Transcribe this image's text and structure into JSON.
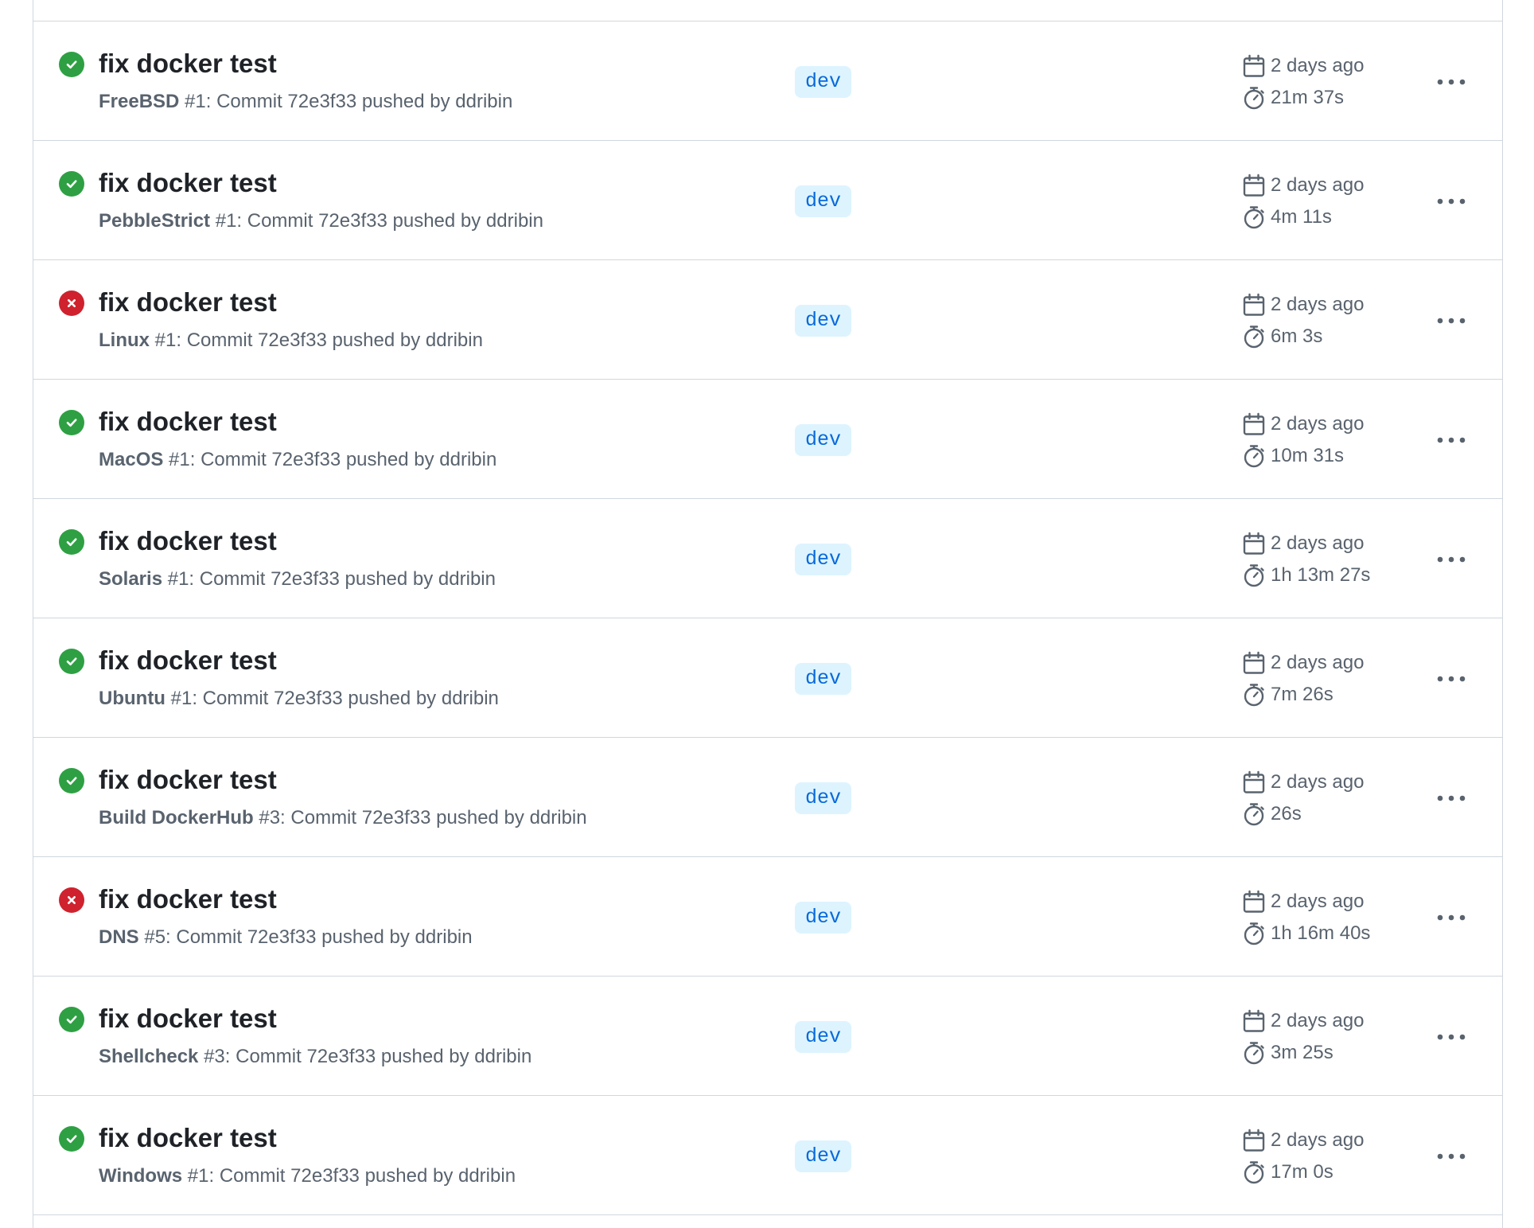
{
  "colors": {
    "success": "#2ea043",
    "failure": "#cf222e",
    "branch_bg": "#ddf4ff",
    "branch_fg": "#0969da",
    "muted": "#59636e",
    "border": "#d0d7de"
  },
  "icons": {
    "success": "check-circle-fill-icon",
    "failure": "x-circle-fill-icon",
    "date": "calendar-icon",
    "duration": "stopwatch-icon",
    "menu": "kebab-horizontal-icon"
  },
  "runs": [
    {
      "status": "success",
      "title": "fix docker test",
      "workflow": "FreeBSD",
      "run": "#1: Commit 72e3f33 pushed by ddribin",
      "branch": "dev",
      "when": "2 days ago",
      "duration": "21m 37s"
    },
    {
      "status": "success",
      "title": "fix docker test",
      "workflow": "PebbleStrict",
      "run": "#1: Commit 72e3f33 pushed by ddribin",
      "branch": "dev",
      "when": "2 days ago",
      "duration": "4m 11s"
    },
    {
      "status": "failure",
      "title": "fix docker test",
      "workflow": "Linux",
      "run": "#1: Commit 72e3f33 pushed by ddribin",
      "branch": "dev",
      "when": "2 days ago",
      "duration": "6m 3s"
    },
    {
      "status": "success",
      "title": "fix docker test",
      "workflow": "MacOS",
      "run": "#1: Commit 72e3f33 pushed by ddribin",
      "branch": "dev",
      "when": "2 days ago",
      "duration": "10m 31s"
    },
    {
      "status": "success",
      "title": "fix docker test",
      "workflow": "Solaris",
      "run": "#1: Commit 72e3f33 pushed by ddribin",
      "branch": "dev",
      "when": "2 days ago",
      "duration": "1h 13m 27s"
    },
    {
      "status": "success",
      "title": "fix docker test",
      "workflow": "Ubuntu",
      "run": "#1: Commit 72e3f33 pushed by ddribin",
      "branch": "dev",
      "when": "2 days ago",
      "duration": "7m 26s"
    },
    {
      "status": "success",
      "title": "fix docker test",
      "workflow": "Build DockerHub",
      "run": "#3: Commit 72e3f33 pushed by ddribin",
      "branch": "dev",
      "when": "2 days ago",
      "duration": "26s"
    },
    {
      "status": "failure",
      "title": "fix docker test",
      "workflow": "DNS",
      "run": "#5: Commit 72e3f33 pushed by ddribin",
      "branch": "dev",
      "when": "2 days ago",
      "duration": "1h 16m 40s"
    },
    {
      "status": "success",
      "title": "fix docker test",
      "workflow": "Shellcheck",
      "run": "#3: Commit 72e3f33 pushed by ddribin",
      "branch": "dev",
      "when": "2 days ago",
      "duration": "3m 25s"
    },
    {
      "status": "success",
      "title": "fix docker test",
      "workflow": "Windows",
      "run": "#1: Commit 72e3f33 pushed by ddribin",
      "branch": "dev",
      "when": "2 days ago",
      "duration": "17m 0s"
    }
  ]
}
